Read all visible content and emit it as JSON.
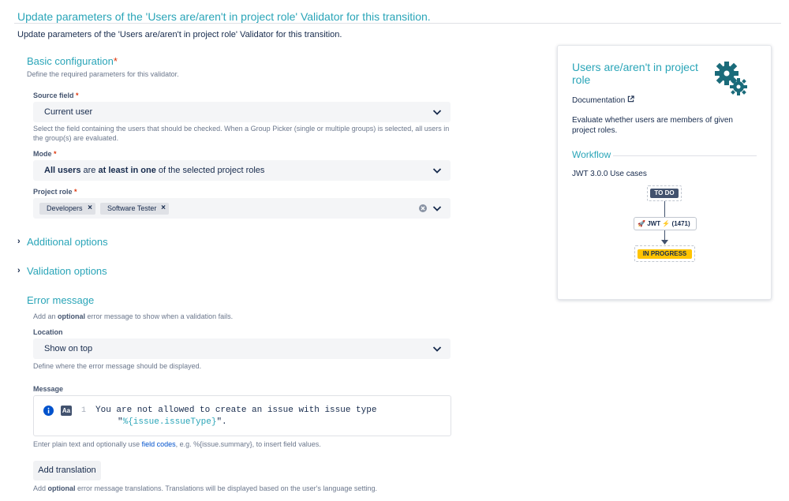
{
  "header": {
    "title": "Update parameters of the 'Users are/aren't in project role' Validator for this transition.",
    "subtitle": "Update parameters of the 'Users are/aren't in project role' Validator for this transition."
  },
  "basic": {
    "title": "Basic configuration",
    "required_mark": "*",
    "description": "Define the required parameters for this validator.",
    "source_field": {
      "label": "Source field",
      "value": "Current user",
      "help": "Select the field containing the users that should be checked. When a Group Picker (single or multiple groups) is selected, all users in the group(s) are evaluated."
    },
    "mode": {
      "label": "Mode",
      "value_parts": [
        "All users",
        " are ",
        "at least in one",
        " of the selected project roles"
      ]
    },
    "project_role": {
      "label": "Project role",
      "tags": [
        "Developers",
        "Software Tester"
      ]
    }
  },
  "additional_options": {
    "title": "Additional options"
  },
  "validation_options": {
    "title": "Validation options"
  },
  "error_message": {
    "title": "Error message",
    "description_parts": [
      "Add an ",
      "optional",
      " error message to show when a validation fails."
    ],
    "location": {
      "label": "Location",
      "value": "Show on top",
      "help": "Define where the error message should be displayed."
    },
    "message": {
      "label": "Message",
      "line_number": "1",
      "line1": "You are not allowed to create an issue with issue type",
      "line2_quote_open": "\"",
      "line2_var": "%{issue.issueType}",
      "line2_end": "\".",
      "help_parts": [
        "Enter plain text and optionally use ",
        "field codes",
        ", e.g. %{issue.summary}, to insert field values."
      ]
    },
    "add_translation": "Add translation",
    "translation_help_parts": [
      "Add ",
      "optional",
      " error message translations. Translations will be displayed based on the user's language setting."
    ]
  },
  "side_card": {
    "title": "Users are/aren't in project role",
    "documentation": "Documentation",
    "description": "Evaluate whether users are members of given project roles.",
    "workflow_title": "Workflow",
    "use_cases": "JWT 3.0.0 Use cases",
    "workflow": {
      "from_status": "TO DO",
      "transition": "JWT",
      "transition_count": "(1471)",
      "to_status": "IN PROGRESS"
    }
  },
  "colors": {
    "accent": "#2aa5b8",
    "required": "#de350b",
    "todo": "#42526e",
    "in_progress": "#ffc400",
    "var": "#2aa5b8"
  },
  "icons": [
    "chevron-down-icon",
    "clear-icon",
    "tag-remove-icon",
    "info-icon",
    "aa-icon",
    "external-link-icon",
    "gears-icon",
    "chevron-right-icon"
  ]
}
